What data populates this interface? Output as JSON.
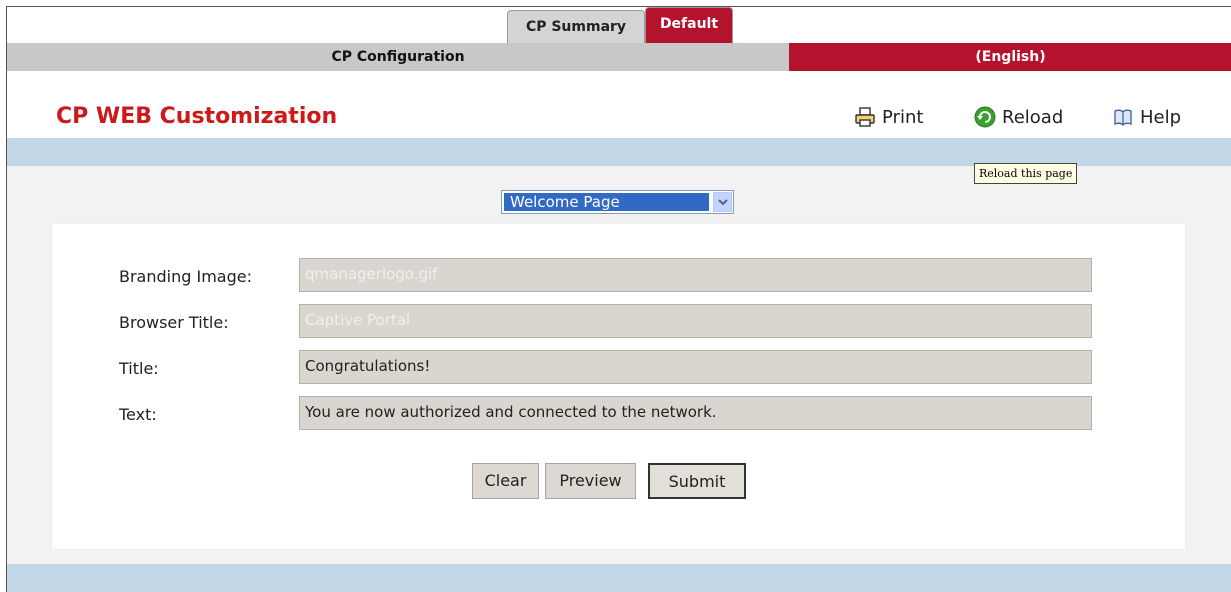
{
  "tabs": [
    {
      "label": "CP Summary",
      "active": false
    },
    {
      "label": "Default",
      "active": true
    }
  ],
  "config_bar": {
    "left": "CP Configuration",
    "right": "(English)"
  },
  "page": {
    "title": "CP WEB Customization"
  },
  "actions": {
    "print": "Print",
    "reload": "Reload",
    "help": "Help"
  },
  "tooltip": "Reload this page",
  "page_select": {
    "value": "Welcome Page"
  },
  "form": {
    "fields": [
      {
        "label": "Branding Image:",
        "value": "qmanagerlogo.gif",
        "disabled": true
      },
      {
        "label": "Browser Title:",
        "value": "Captive Portal",
        "disabled": true
      },
      {
        "label": "Title:",
        "value": "Congratulations!",
        "disabled": false
      },
      {
        "label": "Text:",
        "value": "You are now authorized and connected to the network.",
        "disabled": false
      }
    ]
  },
  "buttons": {
    "clear": "Clear",
    "preview": "Preview",
    "submit": "Submit"
  },
  "colors": {
    "brand_red": "#b5122e",
    "title_red": "#cc1a1a",
    "band_blue": "#c2d7e6"
  },
  "icons": {
    "print": "printer-icon",
    "reload": "reload-icon",
    "help": "help-book-icon",
    "dropdown": "chevron-down-icon"
  }
}
